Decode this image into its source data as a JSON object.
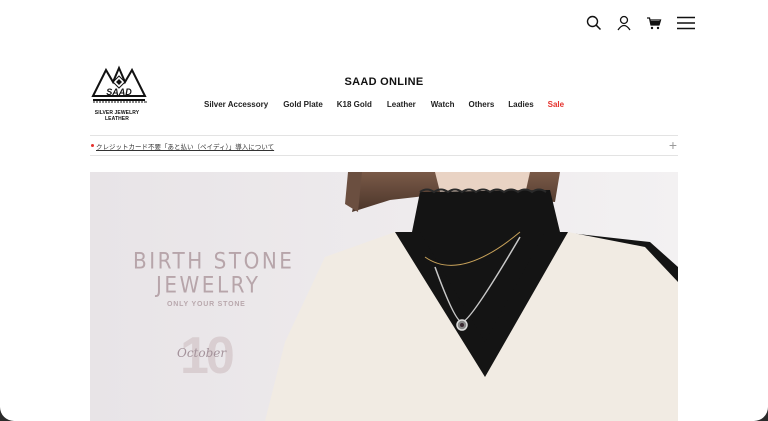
{
  "header": {
    "icons": [
      "search-icon",
      "user-icon",
      "cart-icon",
      "menu-icon"
    ],
    "site_title": "SAAD ONLINE",
    "logo": {
      "name": "SAAD",
      "sub1": "SILVER JEWELRY",
      "sub2": "LEATHER"
    }
  },
  "nav": {
    "items": [
      {
        "label": "Silver Accessory"
      },
      {
        "label": "Gold Plate"
      },
      {
        "label": "K18 Gold"
      },
      {
        "label": "Leather"
      },
      {
        "label": "Watch"
      },
      {
        "label": "Others"
      },
      {
        "label": "Ladies"
      },
      {
        "label": "Sale",
        "color": "#e5322d"
      }
    ]
  },
  "notice": {
    "text": "クレジットカード不要「あと払い（ペイディ）」導入について",
    "expand_symbol": "+"
  },
  "hero": {
    "line1": "BIRTH STONE",
    "line2": "JEWELRY",
    "line3": "ONLY YOUR STONE",
    "number": "10",
    "month": "October"
  }
}
